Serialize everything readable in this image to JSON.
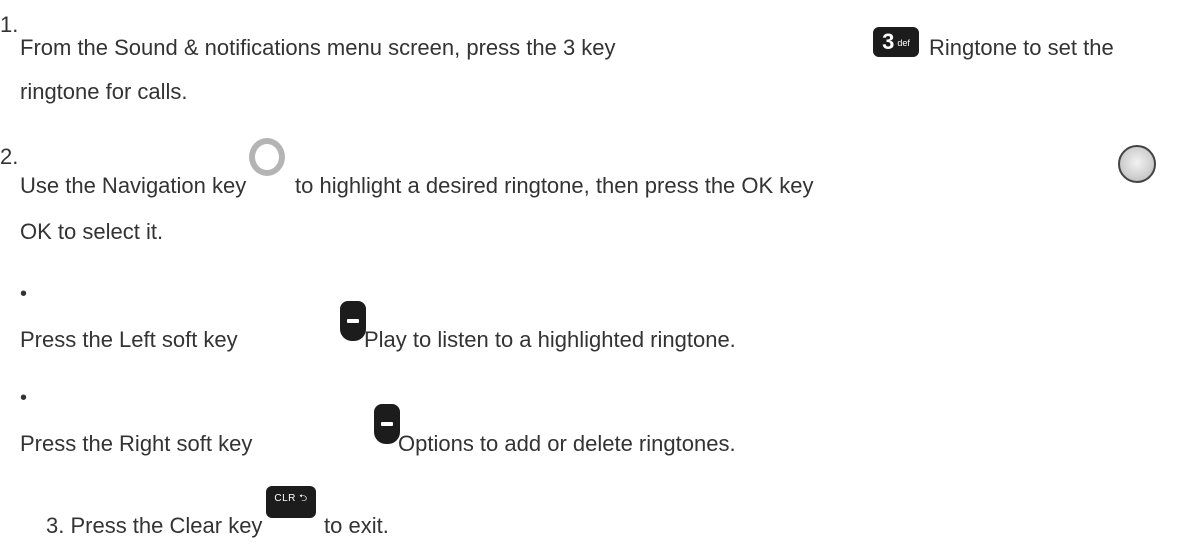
{
  "steps": [
    {
      "number": "1.",
      "line1_before": "From the Sound & notifications menu screen, press the 3 key",
      "line1_after": "Ringtone to set the",
      "line2": "ringtone for calls."
    },
    {
      "number": "2.",
      "line1_before": "Use the Navigation key",
      "line1_middle": "to highlight a desired ringtone, then press the OK key",
      "line2": "OK to select it."
    }
  ],
  "bullets": [
    {
      "symbol": "•",
      "before": "Press the Left soft key",
      "after": "Play to listen to a highlighted ringtone."
    },
    {
      "symbol": "•",
      "before": "Press the Right soft key",
      "after": "Options to add or delete ringtones."
    }
  ],
  "step3": {
    "before": "3. Press the Clear key",
    "after": "to exit."
  },
  "icons": {
    "key3_big": "3",
    "key3_small": "def",
    "clear_label": "CLR ⮌",
    "colors": {
      "key_bg": "#1c1c1c",
      "nav_ring": "#b4b4b4",
      "text": "#333333"
    }
  }
}
